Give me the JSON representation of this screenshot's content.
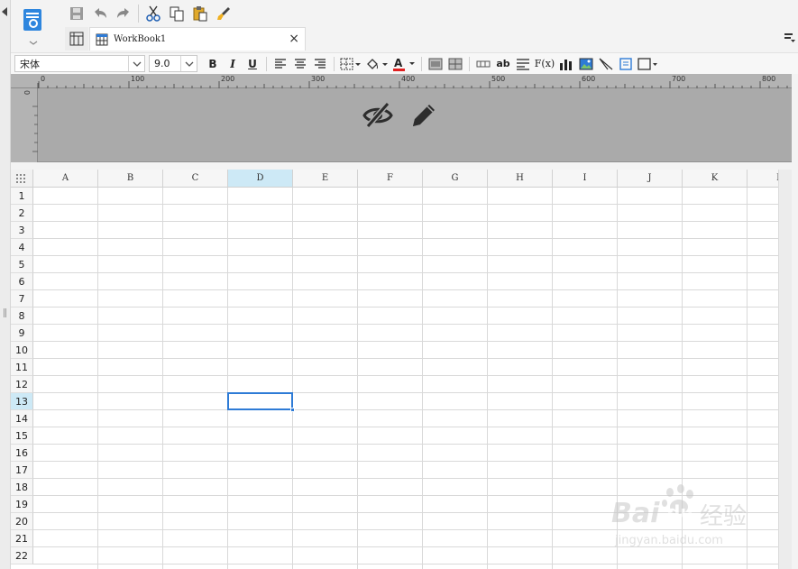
{
  "toolbar": {
    "save": "save-icon",
    "undo": "undo-icon",
    "redo": "redo-icon",
    "cut": "cut-icon",
    "copy": "copy-icon",
    "paste": "paste-icon",
    "format_painter": "brush-icon"
  },
  "tab": {
    "label": "WorkBook1",
    "close": "×"
  },
  "format": {
    "font_family": "宋体",
    "font_size": "9.0",
    "bold": "B",
    "italic": "I",
    "underline": "U",
    "wrap_label": "ab",
    "formula_label": "F(x)",
    "font_color": "#e02020"
  },
  "ruler": {
    "marks": [
      "0",
      "100",
      "200",
      "300",
      "400",
      "500",
      "600",
      "700",
      "800"
    ],
    "left_mark": "0"
  },
  "header_tools": {
    "hide": "eye-slash-icon",
    "edit": "pencil-icon"
  },
  "sheet": {
    "columns": [
      "A",
      "B",
      "C",
      "D",
      "E",
      "F",
      "G",
      "H",
      "I",
      "J",
      "K"
    ],
    "rows": [
      "1",
      "2",
      "3",
      "4",
      "5",
      "6",
      "7",
      "8",
      "9",
      "10",
      "11",
      "12",
      "13",
      "14",
      "15",
      "16",
      "17",
      "18",
      "19",
      "20",
      "21",
      "22"
    ],
    "selected_column": "D",
    "selected_row": "13",
    "next_column_partial": "L"
  },
  "watermark": {
    "brand": "Bai",
    "brand2": "du",
    "suffix": "经验",
    "url": "jingyan.baidu.com"
  },
  "colors": {
    "accent": "#2e7bd6",
    "selected_header": "#cde9f6",
    "header_area": "#aaaaaa"
  }
}
